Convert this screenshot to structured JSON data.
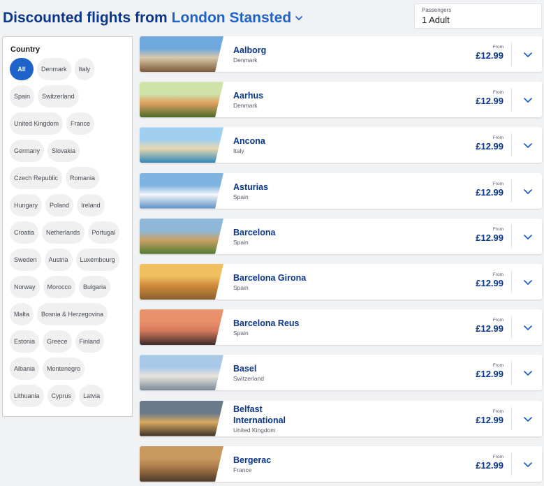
{
  "header": {
    "title": "Discounted flights from",
    "origin": "London Stansted",
    "chevron_icon": "chevron-down-icon"
  },
  "passengers": {
    "label": "Passengers",
    "value": "1 Adult"
  },
  "filter": {
    "title": "Country",
    "chips": [
      {
        "label": "All",
        "active": true
      },
      {
        "label": "Denmark"
      },
      {
        "label": "Italy"
      },
      {
        "label": "Spain"
      },
      {
        "label": "Switzerland"
      },
      {
        "label": "United Kingdom"
      },
      {
        "label": "France"
      },
      {
        "label": "Germany"
      },
      {
        "label": "Slovakia"
      },
      {
        "label": "Czech Republic"
      },
      {
        "label": "Romania"
      },
      {
        "label": "Hungary"
      },
      {
        "label": "Poland"
      },
      {
        "label": "Ireland"
      },
      {
        "label": "Croatia"
      },
      {
        "label": "Netherlands"
      },
      {
        "label": "Portugal"
      },
      {
        "label": "Sweden"
      },
      {
        "label": "Austria"
      },
      {
        "label": "Luxembourg"
      },
      {
        "label": "Norway"
      },
      {
        "label": "Morocco"
      },
      {
        "label": "Bulgaria"
      },
      {
        "label": "Malta"
      },
      {
        "label": "Bosnia & Herzegovina"
      },
      {
        "label": "Estonia"
      },
      {
        "label": "Greece"
      },
      {
        "label": "Finland"
      },
      {
        "label": "Albania"
      },
      {
        "label": "Montenegro"
      },
      {
        "label": "Lithuania"
      },
      {
        "label": "Cyprus"
      },
      {
        "label": "Latvia"
      }
    ]
  },
  "colors": {
    "accent": "#1e63c9",
    "brand_navy": "#073590"
  },
  "destinations": [
    {
      "name": "Aalborg",
      "country": "Denmark",
      "from": "From",
      "price": "£12.99",
      "thumb": [
        "#6fa8dc",
        "#d9c9a8",
        "#7a5a3a"
      ]
    },
    {
      "name": "Aarhus",
      "country": "Denmark",
      "from": "From",
      "price": "£12.99",
      "thumb": [
        "#cfe2a8",
        "#e0a060",
        "#4a6a2a"
      ]
    },
    {
      "name": "Ancona",
      "country": "Italy",
      "from": "From",
      "price": "£12.99",
      "thumb": [
        "#9fd0ef",
        "#e8d8b0",
        "#2f88b8"
      ]
    },
    {
      "name": "Asturias",
      "country": "Spain",
      "from": "From",
      "price": "£12.99",
      "thumb": [
        "#7fb3e0",
        "#f4f6f9",
        "#5d8fc4"
      ]
    },
    {
      "name": "Barcelona",
      "country": "Spain",
      "from": "From",
      "price": "£12.99",
      "thumb": [
        "#8fb8d8",
        "#c9a264",
        "#4f7a34"
      ]
    },
    {
      "name": "Barcelona Girona",
      "country": "Spain",
      "from": "From",
      "price": "£12.99",
      "thumb": [
        "#f0c060",
        "#d08a3a",
        "#8a6030"
      ]
    },
    {
      "name": "Barcelona Reus",
      "country": "Spain",
      "from": "From",
      "price": "£12.99",
      "thumb": [
        "#e8906a",
        "#d67a5c",
        "#3a2a2a"
      ]
    },
    {
      "name": "Basel",
      "country": "Switzerland",
      "from": "From",
      "price": "£12.99",
      "thumb": [
        "#a8c8e8",
        "#e8e4dc",
        "#7a8a9a"
      ]
    },
    {
      "name": "Belfast International",
      "country": "United Kingdom",
      "from": "From",
      "price": "£12.99",
      "thumb": [
        "#6a7a8a",
        "#d8a860",
        "#3a3028"
      ]
    },
    {
      "name": "Bergerac",
      "country": "France",
      "from": "From",
      "price": "£12.99",
      "thumb": [
        "#c89a60",
        "#a87848",
        "#4a3a2a"
      ]
    }
  ],
  "expand_icon": "chevron-down-icon"
}
